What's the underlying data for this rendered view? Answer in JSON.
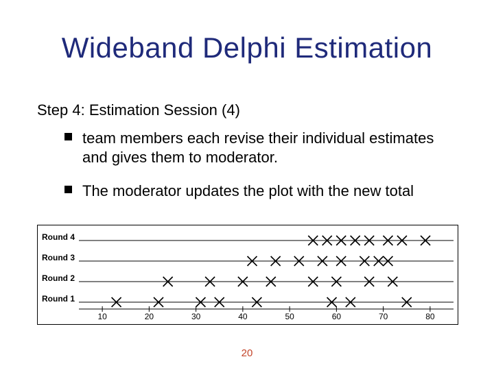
{
  "title": "Wideband Delphi Estimation",
  "subtitle": "Step 4: Estimation Session (4)",
  "bullets": [
    "team members each revise their individual estimates and gives them to moderator.",
    "The moderator updates the plot with the new total"
  ],
  "slide_number": "20",
  "chart_data": {
    "type": "scatter",
    "xlabel": "",
    "ylabel": "",
    "xlim": [
      5,
      85
    ],
    "x_ticks": [
      10,
      20,
      30,
      40,
      50,
      60,
      70,
      80
    ],
    "rows": [
      "Round 4",
      "Round 3",
      "Round 2",
      "Round 1"
    ],
    "series": [
      {
        "name": "Round 1",
        "x": [
          13,
          22,
          31,
          35,
          43,
          59,
          63,
          75
        ]
      },
      {
        "name": "Round 2",
        "x": [
          24,
          33,
          40,
          46,
          55,
          60,
          67,
          72
        ]
      },
      {
        "name": "Round 3",
        "x": [
          42,
          47,
          52,
          57,
          61,
          66,
          69,
          71
        ]
      },
      {
        "name": "Round 4",
        "x": [
          55,
          58,
          61,
          64,
          67,
          71,
          74,
          79
        ]
      }
    ]
  }
}
